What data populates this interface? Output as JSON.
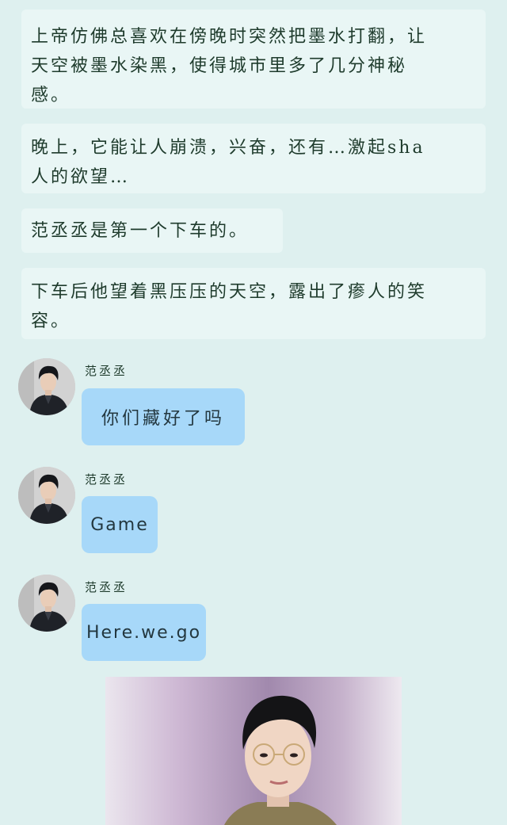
{
  "narration": [
    {
      "line1": "上帝仿佛总喜欢在傍晚时突然把墨水打翻，让",
      "line2": "天空被墨水染黑，使得城市里多了几分神秘",
      "line3": "感。"
    },
    {
      "line1": "晚上，它能让人崩溃，兴奋，还有…激起sha",
      "line2": "人的欲望…"
    },
    {
      "line1": "范丞丞是第一个下车的。"
    },
    {
      "line1": "下车后他望着黑压压的天空，露出了瘆人的笑",
      "line2": "容。"
    }
  ],
  "messages": [
    {
      "sender": "范丞丞",
      "text": "你们藏好了吗"
    },
    {
      "sender": "范丞丞",
      "text": "Game"
    },
    {
      "sender": "范丞丞",
      "text": "Here.we.go"
    }
  ],
  "colors": {
    "background": "#def0ef",
    "narration_box": "#e9f6f5",
    "bubble": "#a7d8f9"
  }
}
